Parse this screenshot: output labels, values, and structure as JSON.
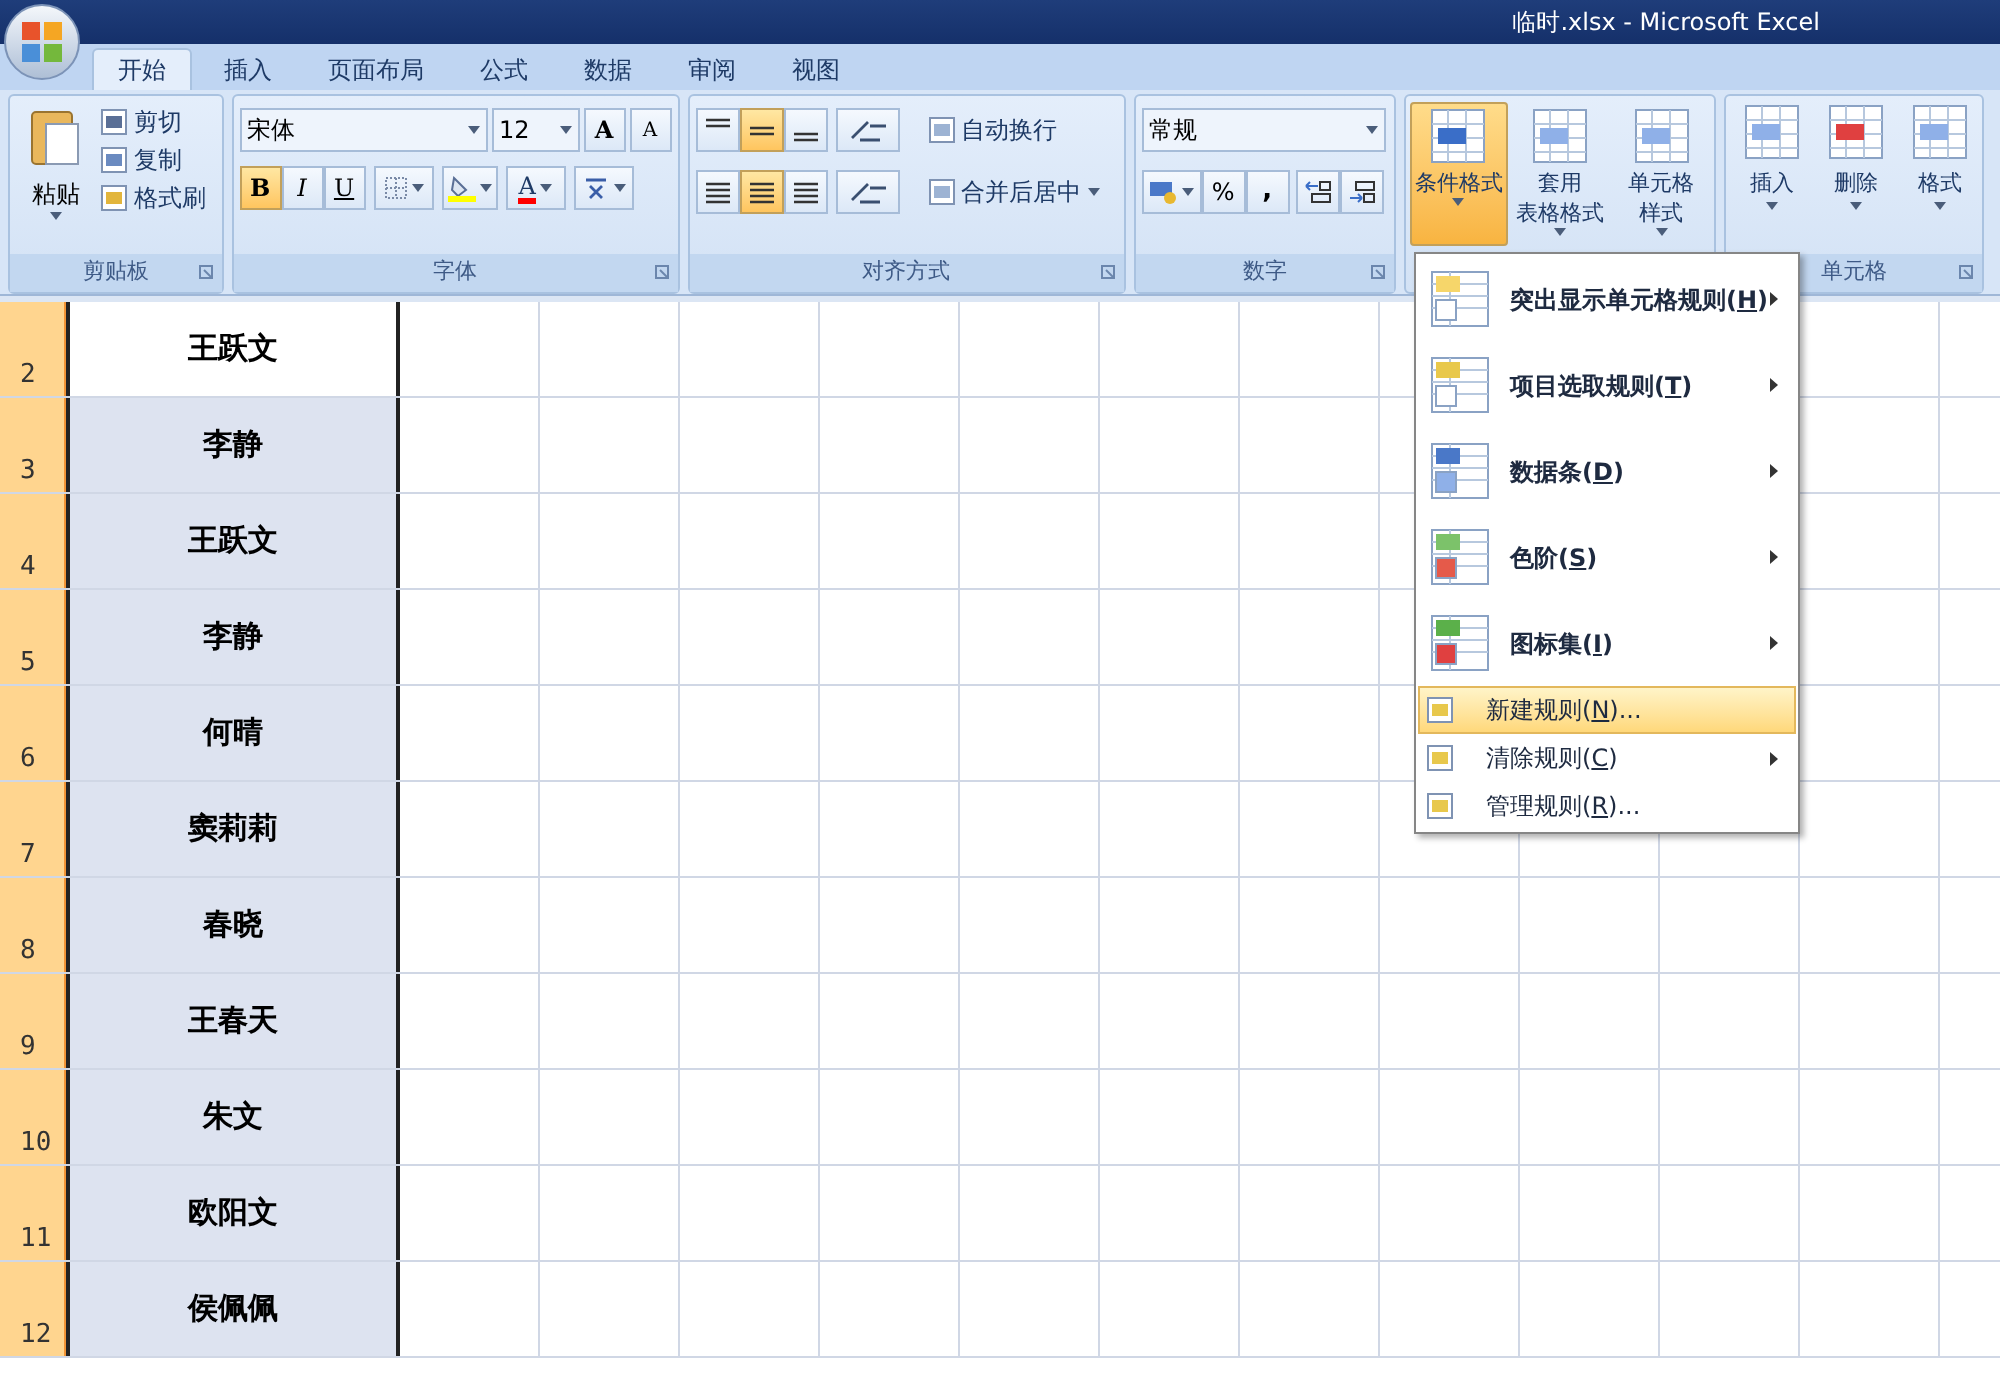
{
  "window": {
    "title": "临时.xlsx - Microsoft Excel"
  },
  "tabs": [
    {
      "label": "开始",
      "selected": true
    },
    {
      "label": "插入",
      "selected": false
    },
    {
      "label": "页面布局",
      "selected": false
    },
    {
      "label": "公式",
      "selected": false
    },
    {
      "label": "数据",
      "selected": false
    },
    {
      "label": "审阅",
      "selected": false
    },
    {
      "label": "视图",
      "selected": false
    }
  ],
  "ribbon": {
    "clipboard": {
      "label": "剪贴板",
      "paste": "粘贴",
      "items": [
        "剪切",
        "复制",
        "格式刷"
      ]
    },
    "font": {
      "label": "字体",
      "font_name": "宋体",
      "font_size": "12",
      "grow": "A",
      "shrink": "A",
      "styles": [
        {
          "label": "B",
          "selected": true
        },
        {
          "label": "I",
          "selected": false
        },
        {
          "label": "U",
          "selected": false
        }
      ],
      "font_color": "A"
    },
    "alignment": {
      "label": "对齐方式",
      "vertical": [
        {
          "selected": false
        },
        {
          "selected": true
        },
        {
          "selected": false
        }
      ],
      "horizontal": [
        {
          "selected": false
        },
        {
          "selected": true
        },
        {
          "selected": false
        }
      ],
      "wrap": "自动换行",
      "merge": "合并后居中"
    },
    "number": {
      "label": "数字",
      "format": "常规",
      "percent": "%",
      "comma": ","
    },
    "styles": {
      "buttons": [
        {
          "lines": [
            "条件格式"
          ],
          "selected": true
        },
        {
          "lines": [
            "套用",
            "表格格式"
          ],
          "selected": false
        },
        {
          "lines": [
            "单元格",
            "样式"
          ],
          "selected": false
        }
      ]
    },
    "cells": {
      "label": "单元格",
      "buttons": [
        "插入",
        "删除",
        "格式"
      ]
    }
  },
  "sheet": {
    "rows": [
      {
        "number": "2",
        "value": "王跃文",
        "active": true
      },
      {
        "number": "3",
        "value": "李静",
        "active": false
      },
      {
        "number": "4",
        "value": "王跃文",
        "active": false
      },
      {
        "number": "5",
        "value": "李静",
        "active": false
      },
      {
        "number": "6",
        "value": "何晴",
        "active": false
      },
      {
        "number": "7",
        "value": "窦莉莉",
        "active": false
      },
      {
        "number": "8",
        "value": "春晓",
        "active": false
      },
      {
        "number": "9",
        "value": "王春天",
        "active": false
      },
      {
        "number": "10",
        "value": "朱文",
        "active": false
      },
      {
        "number": "11",
        "value": "欧阳文",
        "active": false
      },
      {
        "number": "12",
        "value": "侯佩佩",
        "active": false
      }
    ]
  },
  "menu": {
    "items": [
      {
        "kind": "large",
        "label": "突出显示单元格规则(",
        "mnemonic": "H",
        "tail": ")",
        "submenu": true,
        "highlighted": false
      },
      {
        "kind": "large",
        "label": "项目选取规则(",
        "mnemonic": "T",
        "tail": ")",
        "submenu": true,
        "highlighted": false
      },
      {
        "kind": "large",
        "label": "数据条(",
        "mnemonic": "D",
        "tail": ")",
        "submenu": true,
        "highlighted": false
      },
      {
        "kind": "large",
        "label": "色阶(",
        "mnemonic": "S",
        "tail": ")",
        "submenu": true,
        "highlighted": false
      },
      {
        "kind": "large",
        "label": "图标集(",
        "mnemonic": "I",
        "tail": ")",
        "submenu": true,
        "highlighted": false
      },
      {
        "kind": "small",
        "label": "新建规则(",
        "mnemonic": "N",
        "tail": ")...",
        "submenu": false,
        "highlighted": true
      },
      {
        "kind": "small",
        "label": "清除规则(",
        "mnemonic": "C",
        "tail": ")",
        "submenu": true,
        "highlighted": false
      },
      {
        "kind": "small",
        "label": "管理规则(",
        "mnemonic": "R",
        "tail": ")...",
        "submenu": false,
        "highlighted": false
      }
    ]
  }
}
